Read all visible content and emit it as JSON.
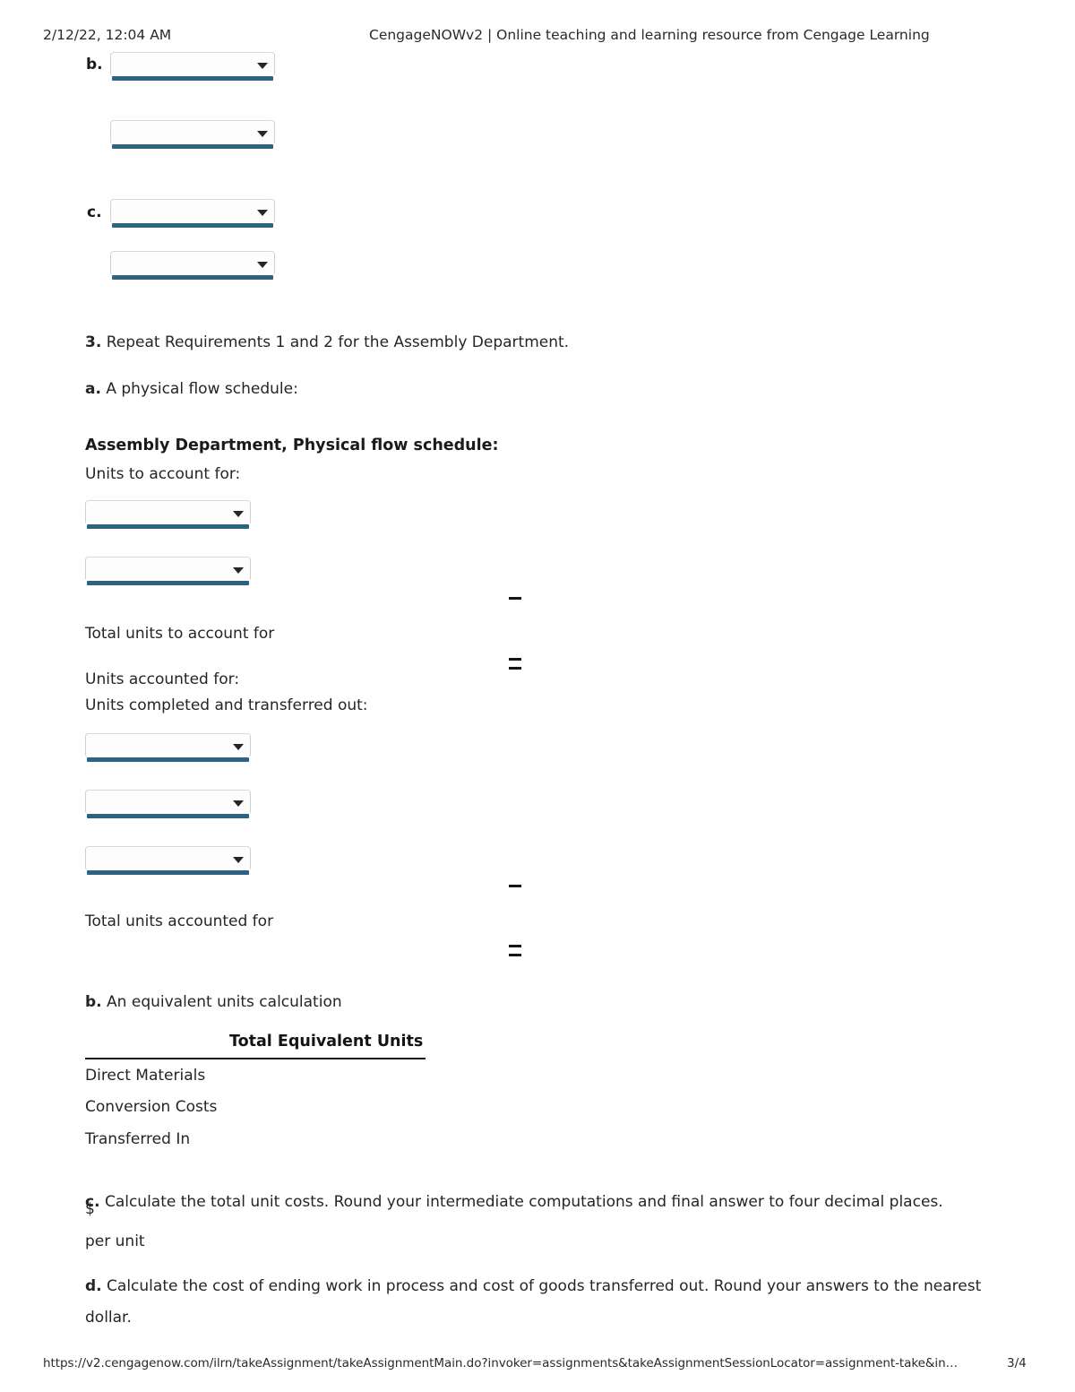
{
  "print_header": {
    "date": "2/12/22, 12:04 AM",
    "title": "CengageNOWv2 | Online teaching and learning resource from Cengage Learning"
  },
  "print_footer": {
    "url": "https://v2.cengagenow.com/ilrn/takeAssignment/takeAssignmentMain.do?invoker=assignments&takeAssignmentSessionLocator=assignment-take&in…",
    "page": "3/4"
  },
  "theme": {
    "select_underline": "#2d6382",
    "select_border": "#cfcfcf",
    "text": "#252525",
    "rule": "#141414"
  },
  "top_group": {
    "items": [
      {
        "label": "b.",
        "value": "",
        "placeholder": ""
      },
      {
        "label": "",
        "value": "",
        "placeholder": ""
      },
      {
        "label": "c.",
        "value": "",
        "placeholder": ""
      },
      {
        "label": "",
        "value": "",
        "placeholder": ""
      }
    ]
  },
  "requirement_3": {
    "number": "3.",
    "text": "Repeat Requirements 1 and 2 for the Assembly Department."
  },
  "part_a": {
    "letter": "a.",
    "text": "A physical flow schedule:",
    "schedule_title": "Assembly Department, Physical flow schedule:",
    "units_to_account_label": "Units to account for:",
    "units_to_account_selects": [
      {
        "value": "",
        "placeholder": ""
      },
      {
        "value": "",
        "placeholder": ""
      }
    ],
    "total_units_to_account_label": "Total units to account for",
    "units_accounted_label": "Units accounted for:",
    "units_completed_label": "Units completed and transferred out:",
    "units_accounted_selects": [
      {
        "value": "",
        "placeholder": ""
      },
      {
        "value": "",
        "placeholder": ""
      },
      {
        "value": "",
        "placeholder": ""
      }
    ],
    "total_units_accounted_label": "Total units accounted for"
  },
  "part_b": {
    "letter": "b.",
    "text": "An equivalent units calculation",
    "table": {
      "column_header": "Total Equivalent Units",
      "rows": [
        {
          "label": "Direct Materials",
          "value": ""
        },
        {
          "label": "Conversion Costs",
          "value": ""
        },
        {
          "label": "Transferred In",
          "value": ""
        }
      ]
    }
  },
  "part_c": {
    "letter": "c.",
    "text": "Calculate the total unit costs. Round your intermediate computations and final answer to four decimal places.",
    "currency_symbol": "$",
    "amount": "",
    "unit_suffix": "per unit"
  },
  "part_d": {
    "letter": "d.",
    "text": "Calculate the cost of ending work in process and cost of goods transferred out. Round your answers to the nearest dollar."
  }
}
